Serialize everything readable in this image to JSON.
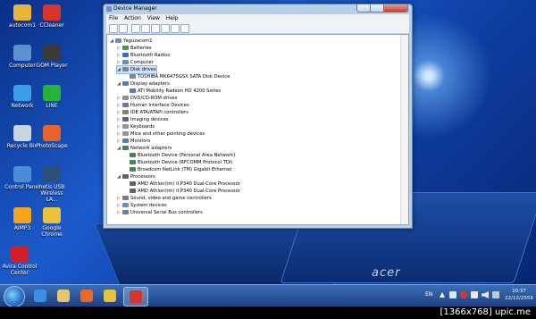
{
  "desktop_icons": [
    {
      "label": "autocom1",
      "icon": "folder-icon",
      "color": "#e8b53a"
    },
    {
      "label": "CCleaner",
      "icon": "ccleaner-icon",
      "color": "#d9342b"
    },
    {
      "label": "Computer",
      "icon": "computer-icon",
      "color": "#5d8fd1"
    },
    {
      "label": "GOM Player",
      "icon": "gom-player-icon",
      "color": "#3a3a3a"
    },
    {
      "label": "Network",
      "icon": "network-icon",
      "color": "#3aa0e6"
    },
    {
      "label": "LINE",
      "icon": "line-icon",
      "color": "#27b33a"
    },
    {
      "label": "Recycle Bin",
      "icon": "recycle-bin-icon",
      "color": "#c8d4e2"
    },
    {
      "label": "PhotoScape",
      "icon": "photoscape-icon",
      "color": "#e8632b"
    },
    {
      "label": "Control Panel",
      "icon": "control-panel-icon",
      "color": "#4a8cd6"
    },
    {
      "label": "netis USB Wireless LA...",
      "icon": "netis-icon",
      "color": "#2d4d7a"
    },
    {
      "label": "AIMP3",
      "icon": "aimp-icon",
      "color": "#f4a51d"
    },
    {
      "label": "Google Chrome",
      "icon": "chrome-icon",
      "color": "#e8c23a"
    },
    {
      "label": "Avira Control Center",
      "icon": "avira-icon",
      "color": "#d01f2a"
    }
  ],
  "window": {
    "title": "Device Manager",
    "menu": [
      "File",
      "Action",
      "View",
      "Help"
    ],
    "tree": [
      {
        "label": "Yaguzacom1",
        "level": 0,
        "expander": "◢",
        "color": "#6b8cc6"
      },
      {
        "label": "Batteries",
        "level": 1,
        "expander": "▷",
        "color": "#4a9a3b"
      },
      {
        "label": "Bluetooth Radios",
        "level": 1,
        "expander": "▷",
        "color": "#2f6fd4"
      },
      {
        "label": "Computer",
        "level": 1,
        "expander": "▷",
        "color": "#5d8fd1"
      },
      {
        "label": "Disk drives",
        "level": 1,
        "expander": "◢",
        "color": "#7d8895",
        "selected": true
      },
      {
        "label": "TOSHIBA MK6475GSX SATA Disk Device",
        "level": 2,
        "expander": "",
        "color": "#7d8895"
      },
      {
        "label": "Display adapters",
        "level": 1,
        "expander": "◢",
        "color": "#4a7fc4"
      },
      {
        "label": "ATI Mobility Radeon HD 4200 Series",
        "level": 2,
        "expander": "",
        "color": "#4a7fc4"
      },
      {
        "label": "DVD/CD-ROM drives",
        "level": 1,
        "expander": "▷",
        "color": "#8a8f98"
      },
      {
        "label": "Human Interface Devices",
        "level": 1,
        "expander": "▷",
        "color": "#6d7b8c"
      },
      {
        "label": "IDE ATA/ATAPI controllers",
        "level": 1,
        "expander": "▷",
        "color": "#7f8a60"
      },
      {
        "label": "Imaging devices",
        "level": 1,
        "expander": "▷",
        "color": "#5b6b7e"
      },
      {
        "label": "Keyboards",
        "level": 1,
        "expander": "▷",
        "color": "#8c95a3"
      },
      {
        "label": "Mice and other pointing devices",
        "level": 1,
        "expander": "▷",
        "color": "#8c95a3"
      },
      {
        "label": "Monitors",
        "level": 1,
        "expander": "▷",
        "color": "#4a7fc4"
      },
      {
        "label": "Network adapters",
        "level": 1,
        "expander": "◢",
        "color": "#3f8a4e"
      },
      {
        "label": "Bluetooth Device (Personal Area Network)",
        "level": 2,
        "expander": "",
        "color": "#3f8a4e"
      },
      {
        "label": "Bluetooth Device (RFCOMM Protocol TDI)",
        "level": 2,
        "expander": "",
        "color": "#3f8a4e"
      },
      {
        "label": "Broadcom NetLink (TM) Gigabit Ethernet",
        "level": 2,
        "expander": "",
        "color": "#3f8a4e"
      },
      {
        "label": "Processors",
        "level": 1,
        "expander": "◢",
        "color": "#5a6472"
      },
      {
        "label": "AMD Athlon(tm) II P340 Dual-Core Processor",
        "level": 2,
        "expander": "",
        "color": "#5a6472"
      },
      {
        "label": "AMD Athlon(tm) II P340 Dual-Core Processor",
        "level": 2,
        "expander": "",
        "color": "#5a6472"
      },
      {
        "label": "Sound, video and game controllers",
        "level": 1,
        "expander": "▷",
        "color": "#6e7e95"
      },
      {
        "label": "System devices",
        "level": 1,
        "expander": "▷",
        "color": "#5d8fd1"
      },
      {
        "label": "Universal Serial Bus controllers",
        "level": 1,
        "expander": "▷",
        "color": "#6e7e95"
      }
    ]
  },
  "taskbar": {
    "pinned": [
      {
        "name": "ie-icon",
        "color": "#3a8ee6"
      },
      {
        "name": "explorer-icon",
        "color": "#e8c56a"
      },
      {
        "name": "media-player-icon",
        "color": "#e86a2b"
      },
      {
        "name": "chrome-icon",
        "color": "#e8c23a"
      },
      {
        "name": "device-manager-icon",
        "color": "#d9342b"
      }
    ],
    "language": "EN",
    "time": "10:37",
    "date": "22/12/2559"
  },
  "watermark": "[1366x768] upic.me",
  "desktop_brand": "acer"
}
